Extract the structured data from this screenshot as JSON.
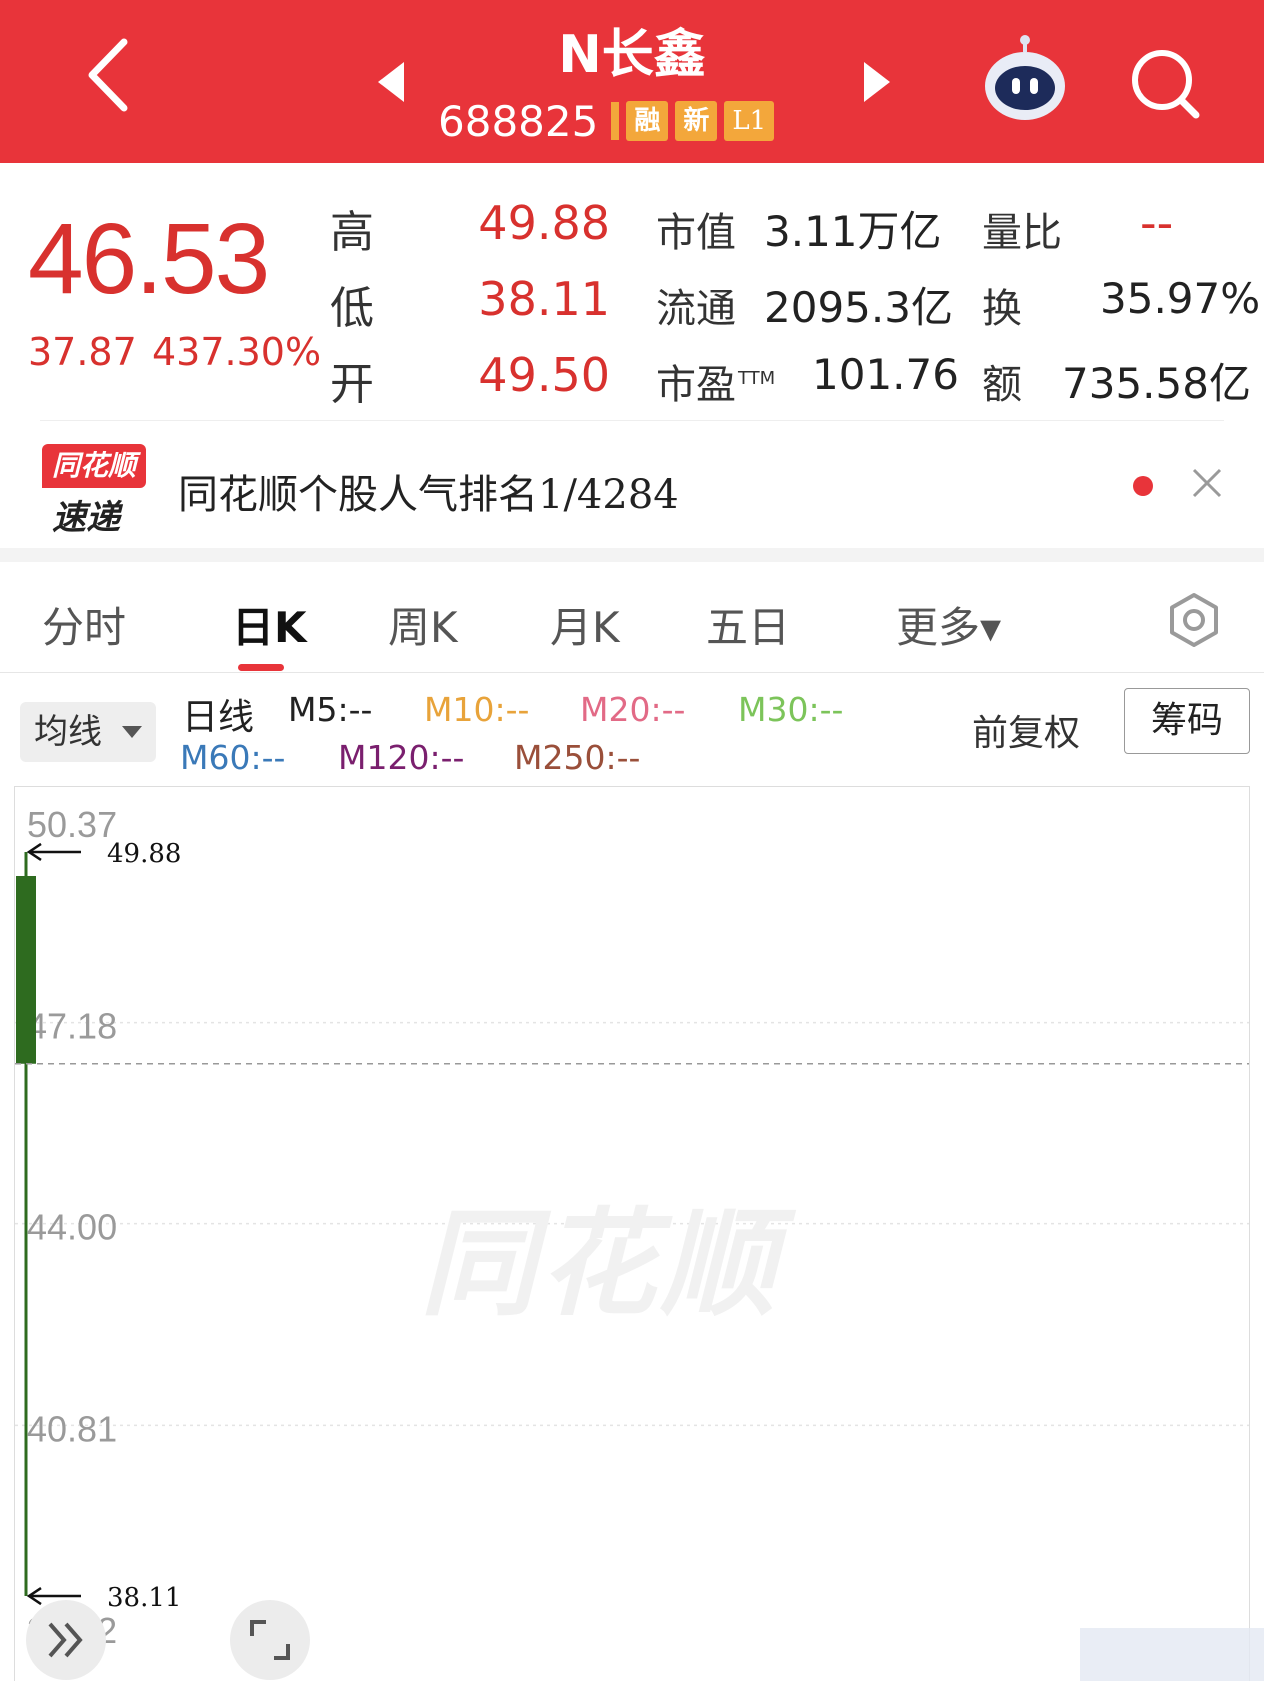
{
  "header": {
    "title": "N长鑫",
    "code": "688825",
    "tags": [
      "融",
      "新",
      "L1"
    ],
    "icons": [
      "back-icon",
      "prev-stock-icon",
      "next-stock-icon",
      "robot-assistant-icon",
      "search-icon"
    ]
  },
  "quote": {
    "price": "46.53",
    "change": "37.87",
    "change_pct": "437.30%",
    "high_label": "高",
    "high": "49.88",
    "low_label": "低",
    "low": "38.11",
    "open_label": "开",
    "open": "49.50",
    "mktcap_label": "市值",
    "mktcap": "3.11万亿",
    "float_label": "流通",
    "float": "2095.3亿",
    "pe_label": "市盈",
    "pe_sup": "TTM",
    "pe": "101.76",
    "vol_ratio_label": "量比",
    "vol_ratio": "--",
    "turnover_label": "换",
    "turnover": "35.97%",
    "amount_label": "额",
    "amount": "735.58亿"
  },
  "ranking": {
    "logo_top": "同花顺",
    "logo_bottom": "速递",
    "text": "同花顺个股人气排名1/4284"
  },
  "tabs": [
    {
      "label": "分时"
    },
    {
      "label": "日K"
    },
    {
      "label": "周K"
    },
    {
      "label": "月K"
    },
    {
      "label": "五日"
    },
    {
      "label": "更多▾"
    }
  ],
  "ma_legend": {
    "selector": "均线",
    "period": "日线",
    "m5": "M5:--",
    "m10": "M10:--",
    "m20": "M20:--",
    "m30": "M30:--",
    "m60": "M60:--",
    "m120": "M120:--",
    "m250": "M250:--",
    "adjust": "前复权",
    "chips": "筹码"
  },
  "colors": {
    "up_red": "#d8312e",
    "down_green": "#2e6b1f",
    "m10": "#e8a33a",
    "m20": "#e26a86",
    "m30": "#7cc45a",
    "m60": "#3a79b8",
    "m120": "#7a1f6e",
    "m250": "#9a4f3a"
  },
  "chart_data": {
    "type": "candlestick",
    "y_ticks": [
      "50.37",
      "47.18",
      "44.00",
      "40.81",
      "37.62"
    ],
    "ylim": [
      37.62,
      50.37
    ],
    "candles": [
      {
        "open": 49.5,
        "close": 46.53,
        "high": 49.88,
        "low": 38.11
      }
    ],
    "high_marker": "49.88",
    "low_marker": "38.11",
    "watermark": "同花顺"
  }
}
